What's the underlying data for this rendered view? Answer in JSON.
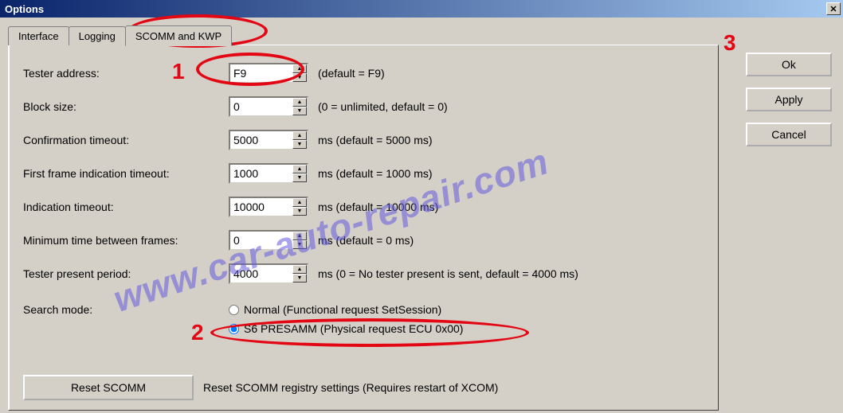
{
  "window": {
    "title": "Options",
    "close": "✕"
  },
  "tabs": {
    "t0": "Interface",
    "t1": "Logging",
    "t2": "SCOMM and KWP"
  },
  "fields": {
    "tester_address": {
      "label": "Tester address:",
      "value": "F9",
      "hint": "(default = F9)"
    },
    "block_size": {
      "label": "Block size:",
      "value": "0",
      "hint": "(0 = unlimited, default = 0)"
    },
    "confirm_timeout": {
      "label": "Confirmation timeout:",
      "value": "5000",
      "hint": "ms (default = 5000 ms)"
    },
    "first_frame": {
      "label": "First frame indication timeout:",
      "value": "1000",
      "hint": "ms (default = 1000 ms)"
    },
    "indication": {
      "label": "Indication timeout:",
      "value": "10000",
      "hint": "ms (default = 10000 ms)"
    },
    "min_frames": {
      "label": "Minimum time between frames:",
      "value": "0",
      "hint": "ms (default = 0 ms)"
    },
    "tester_present": {
      "label": "Tester present period:",
      "value": "4000",
      "hint": "ms (0 = No tester present is sent, default = 4000 ms)"
    }
  },
  "search_mode": {
    "label": "Search mode:",
    "opt_normal": "Normal (Functional request SetSession)",
    "opt_s6": "S6 PRESAMM (Physical request ECU 0x00)"
  },
  "reset": {
    "button": "Reset SCOMM",
    "hint": "Reset SCOMM registry settings (Requires restart of XCOM)"
  },
  "buttons": {
    "ok": "Ok",
    "apply": "Apply",
    "cancel": "Cancel"
  },
  "annotations": {
    "n1": "1",
    "n2": "2",
    "n3": "3"
  },
  "watermark": "www.car-auto-repair.com"
}
